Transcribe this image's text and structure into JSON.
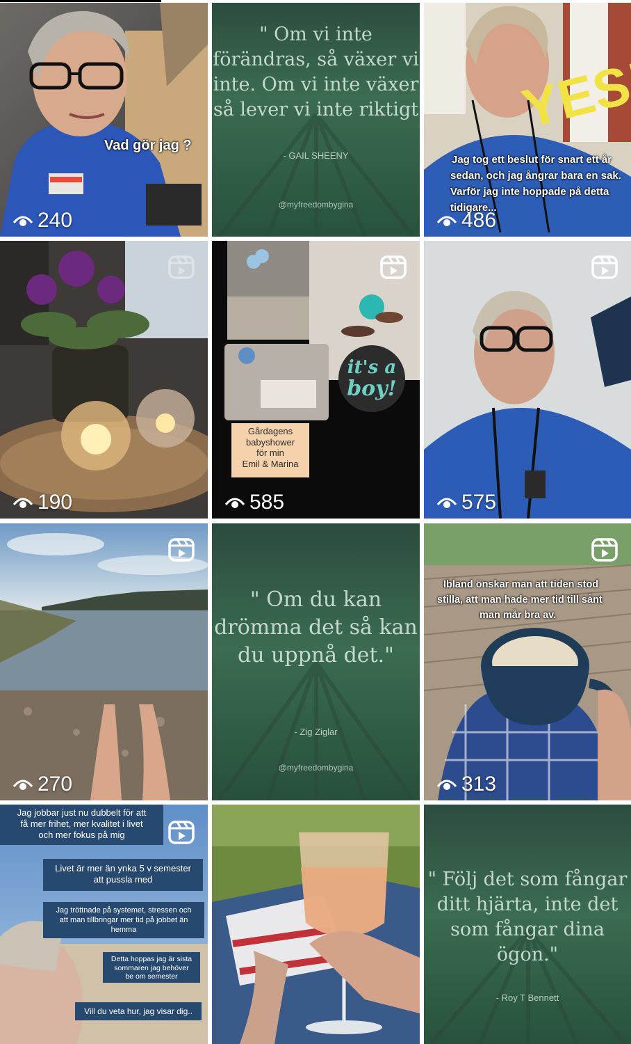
{
  "tiles": [
    {
      "id": "t1",
      "views": "240",
      "caption": "Vad gör jag ?"
    },
    {
      "id": "t2",
      "quote_lines": [
        "\" Om vi inte",
        "förändras, så växer vi",
        "inte. Om vi inte växer",
        "så lever vi inte riktigt"
      ],
      "author": "- GAIL SHEENY",
      "handle": "@myfreedombygina"
    },
    {
      "id": "t3",
      "views": "486",
      "sticker": "YES!",
      "caption_lines": [
        "Jag tog ett beslut för snart ett år",
        "sedan, och jag ångrar bara en sak.",
        "Varför jag inte hoppade på detta",
        "tidigare..."
      ]
    },
    {
      "id": "t4",
      "views": "190"
    },
    {
      "id": "t5",
      "views": "585",
      "sign_lines": [
        "Gårdagens",
        "babyshower",
        "för min",
        "Emil & Marina"
      ],
      "badge_lines": [
        "it's a",
        "boy!"
      ]
    },
    {
      "id": "t6",
      "views": "575"
    },
    {
      "id": "t7",
      "views": "270"
    },
    {
      "id": "t8",
      "quote_lines": [
        "\" Om du kan",
        "drömma det så kan",
        "du uppnå det.\""
      ],
      "author": "- Zig Ziglar",
      "handle": "@myfreedombygina"
    },
    {
      "id": "t9",
      "views": "313",
      "caption_lines": [
        "Ibland önskar man att tiden stod",
        "stilla, att man hade mer tid till sånt",
        "man mår bra av."
      ]
    },
    {
      "id": "t10",
      "boxes": [
        [
          "Jag jobbar just nu dubbelt för att",
          "få mer frihet, mer kvalitet i livet",
          "och mer fokus på mig"
        ],
        [
          "Livet är mer än ynka 5 v semester",
          "att pussla med"
        ],
        [
          "Jag tröttnade på systemet, stressen och",
          "att man tillbringar mer tid på jobbet än",
          "hemma"
        ],
        [
          "Detta hoppas jag är sista",
          "sommaren jag behöver",
          "be om semester"
        ],
        [
          "Vill du veta hur, jag visar dig.."
        ]
      ]
    },
    {
      "id": "t11"
    },
    {
      "id": "t12",
      "quote_lines": [
        "\" Följ det som fångar",
        "ditt hjärta, inte det",
        "som fångar dina",
        "ögon.\""
      ],
      "author": "- Roy T Bennett"
    }
  ],
  "colors": {
    "forest": "#2f5a48",
    "scrub": "#2d5fb8",
    "box": "#27496f"
  },
  "icons": [
    "eye-icon",
    "reel-icon"
  ]
}
